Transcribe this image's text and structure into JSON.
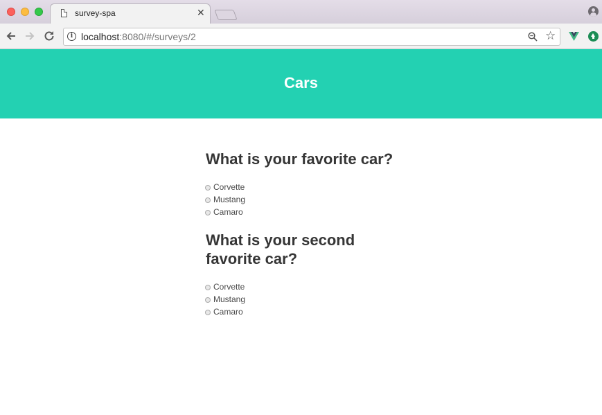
{
  "browser": {
    "tab_title": "survey-spa",
    "url_host": "localhost",
    "url_rest": ":8080/#/surveys/2"
  },
  "icons": {
    "back": "arrow-left-icon",
    "forward": "arrow-right-icon",
    "reload": "reload-icon",
    "info": "info-icon",
    "zoom": "zoom-out-icon",
    "bookmark": "star-icon",
    "vue_devtools": "vue-icon",
    "extension": "upload-icon",
    "profile": "user-icon"
  },
  "colors": {
    "hero_bg": "#23d1b2",
    "title_text": "#363636"
  },
  "hero": {
    "title": "Cars"
  },
  "questions": [
    {
      "text": "What is your favorite car?",
      "options": [
        "Corvette",
        "Mustang",
        "Camaro"
      ]
    },
    {
      "text": "What is your second favorite car?",
      "options": [
        "Corvette",
        "Mustang",
        "Camaro"
      ]
    }
  ]
}
